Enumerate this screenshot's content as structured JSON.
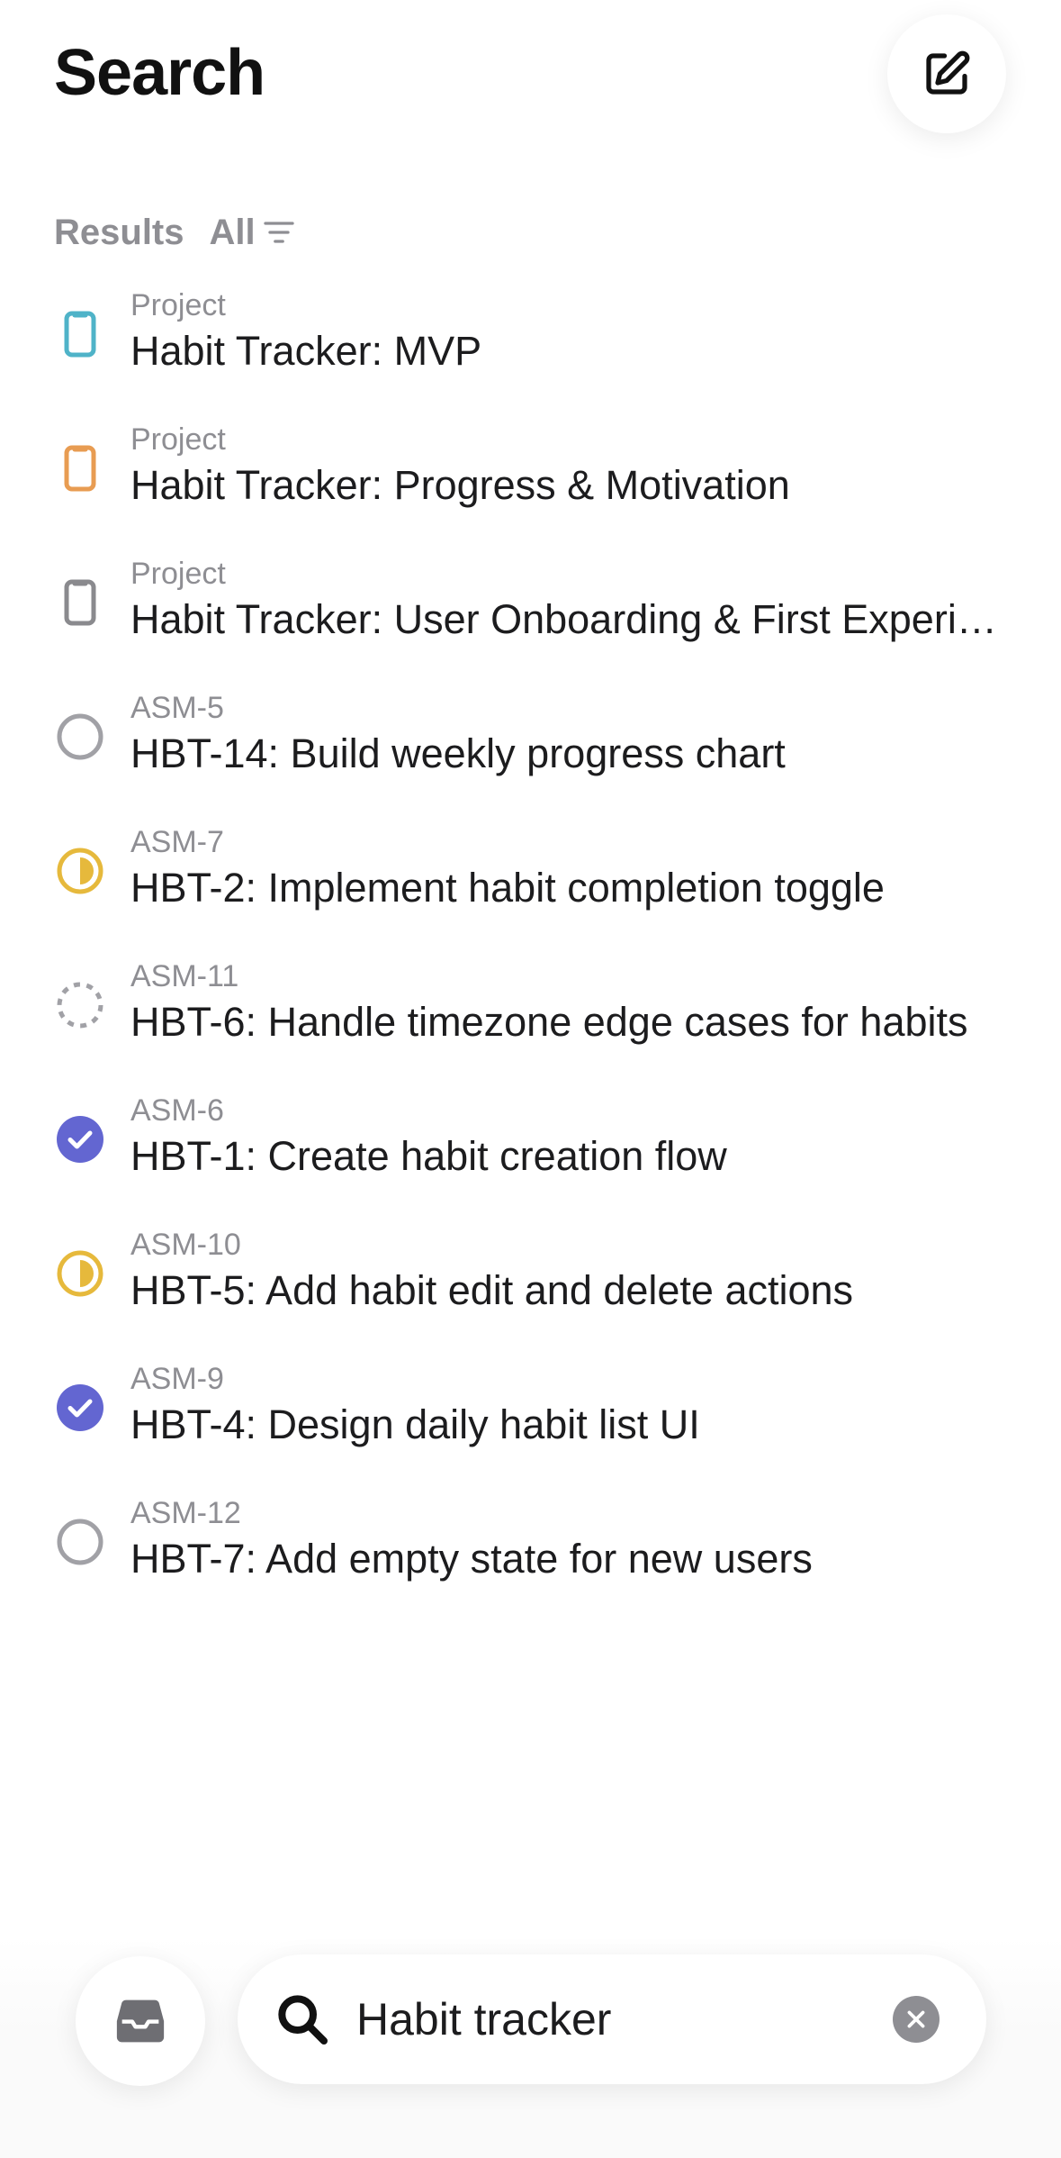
{
  "header": {
    "title": "Search",
    "compose_icon": "compose-icon"
  },
  "results": {
    "label": "Results",
    "filter_label": "All",
    "filter_icon": "filter-icon",
    "items": [
      {
        "subtitle": "Project",
        "title": "Habit Tracker: MVP",
        "icon": "project-icon",
        "color": "#4fb3c8"
      },
      {
        "subtitle": "Project",
        "title": "Habit Tracker: Progress & Motivation",
        "icon": "project-icon",
        "color": "#e89c52"
      },
      {
        "subtitle": "Project",
        "title": "Habit Tracker: User Onboarding & First Experience",
        "icon": "project-icon",
        "color": "#8a8a8e"
      },
      {
        "subtitle": "ASM-5",
        "title": "HBT-14: Build weekly progress chart",
        "icon": "todo-status-icon",
        "color": "#a1a1a6"
      },
      {
        "subtitle": "ASM-7",
        "title": "HBT-2: Implement habit completion toggle",
        "icon": "in-progress-status-icon",
        "color": "#e6b93c"
      },
      {
        "subtitle": "ASM-11",
        "title": "HBT-6: Handle timezone edge cases for habits",
        "icon": "backlog-status-icon",
        "color": "#a1a1a6"
      },
      {
        "subtitle": "ASM-6",
        "title": "HBT-1: Create habit creation flow",
        "icon": "done-status-icon",
        "color": "#6366d1"
      },
      {
        "subtitle": "ASM-10",
        "title": "HBT-5: Add habit edit and delete actions",
        "icon": "in-progress-status-icon",
        "color": "#e6b93c"
      },
      {
        "subtitle": "ASM-9",
        "title": "HBT-4: Design daily habit list UI",
        "icon": "done-status-icon",
        "color": "#6366d1"
      },
      {
        "subtitle": "ASM-12",
        "title": "HBT-7: Add empty state for new users",
        "icon": "todo-status-icon",
        "color": "#a1a1a6"
      }
    ]
  },
  "bottom": {
    "inbox_icon": "inbox-icon",
    "search_icon": "search-icon",
    "search_value": "Habit tracker",
    "clear_icon": "clear-icon"
  }
}
